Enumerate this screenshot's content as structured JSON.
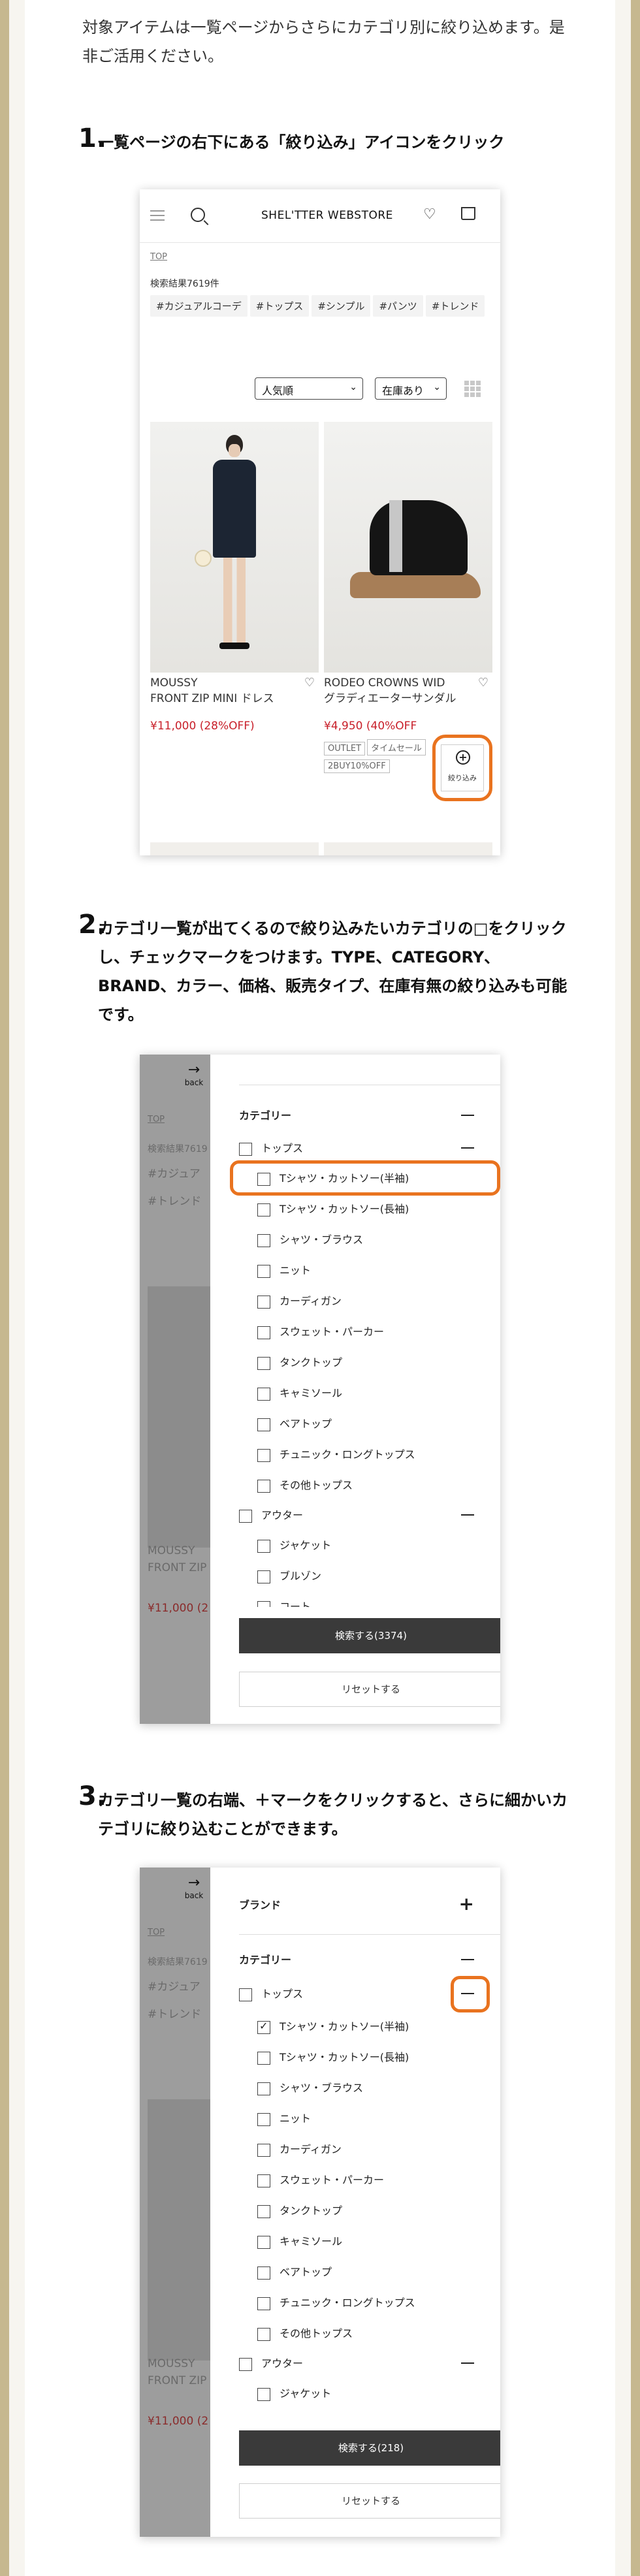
{
  "intro": "対象アイテムは一覧ページからさらにカテゴリ別に絞り込めます。是非ご活用ください。",
  "steps": [
    {
      "num": "1.",
      "text": "一覧ページの右下にある「絞り込み」アイコンをクリック"
    },
    {
      "num": "2.",
      "text": "カテゴリ一覧が出てくるので絞り込みたいカテゴリの□をクリックし、チェックマークをつけます。TYPE、CATEGORY、BRAND、カラー、価格、販売タイプ、在庫有無の絞り込みも可能です。"
    },
    {
      "num": "3.",
      "text": "カテゴリ一覧の右端、＋マークをクリックすると、さらに細かいカテゴリに絞り込むことができます。"
    }
  ],
  "store": {
    "brand": "SHEL'TTER WEBSTORE",
    "top": "TOP",
    "result_count": "検索結果7619件",
    "tags": [
      "#カジュアルコーデ",
      "#トップス",
      "#シンプル",
      "#パンツ",
      "#トレンド"
    ],
    "sort": "人気順",
    "stock": "在庫あり",
    "products": [
      {
        "name": "MOUSSY\nFRONT ZIP MINI ドレス",
        "price": "¥11,000 (28%OFF)",
        "badges": []
      },
      {
        "name": "RODEO CROWNS WID\nグラディエーターサンダル",
        "price": "¥4,950 (40%OFF",
        "badges": [
          "OUTLET",
          "タイムセール",
          "2BUY10%OFF"
        ]
      }
    ],
    "filter_label": "絞り込み"
  },
  "filter": {
    "back": "back",
    "brand_label": "ブランド",
    "category_label": "カテゴリー",
    "tops": "トップス",
    "tops_items": [
      "Tシャツ・カットソー(半袖)",
      "Tシャツ・カットソー(長袖)",
      "シャツ・ブラウス",
      "ニット",
      "カーディガン",
      "スウェット・パーカー",
      "タンクトップ",
      "キャミソール",
      "ベアトップ",
      "チュニック・ロングトップス",
      "その他トップス"
    ],
    "outer": "アウター",
    "outer_items_p2": [
      "ジャケット",
      "ブルゾン",
      "コート"
    ],
    "outer_items_p3": [
      "ジャケット"
    ],
    "search_p2": "検索する(3374)",
    "search_p3": "検索する(218)",
    "reset": "リセットする"
  },
  "bg_texts": {
    "top": "TOP",
    "count": "検索結果7619",
    "tag1": "#カジュア",
    "tag2": "#トレンド",
    "name1": "MOUSSY",
    "name2": "FRONT ZIP",
    "price": "¥11,000 (2"
  },
  "colors": {
    "accent": "#e9731f",
    "price": "#c8202a",
    "frame": "#c6b88f"
  }
}
